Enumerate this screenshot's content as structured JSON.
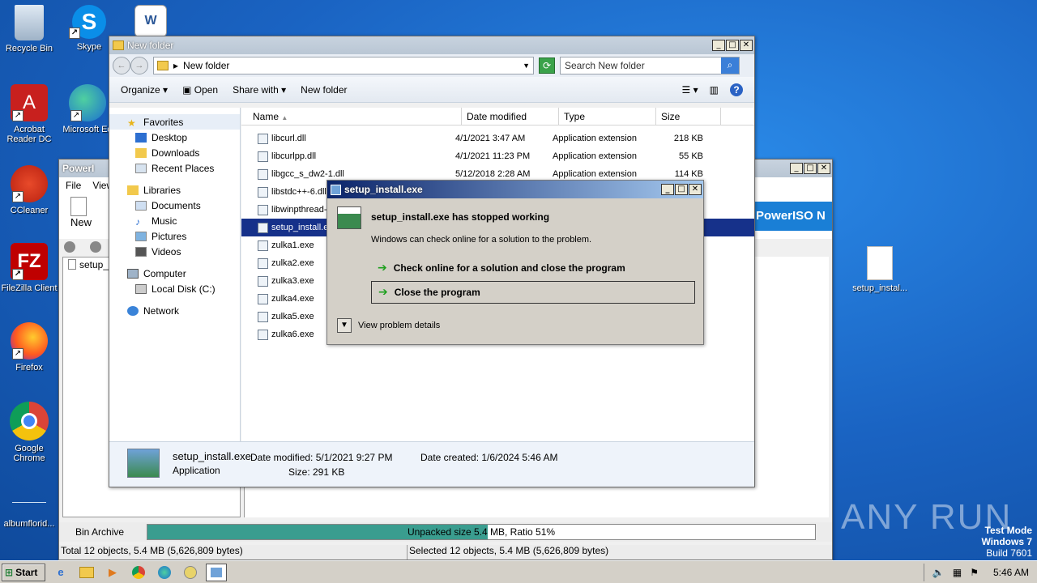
{
  "desktop": {
    "icons": [
      {
        "label": "Recycle Bin"
      },
      {
        "label": "Skype"
      },
      {
        "label": "Acrobat Reader DC"
      },
      {
        "label": "Microsoft Ed"
      },
      {
        "label": "CCleaner"
      },
      {
        "label": "FileZilla Client"
      },
      {
        "label": "Firefox"
      },
      {
        "label": "Google Chrome"
      },
      {
        "label": "albumflorid..."
      },
      {
        "label": "setup_instal..."
      }
    ],
    "watermark": "ANY RUN",
    "test_mode": {
      "line1": "Test Mode",
      "line2": "Windows 7",
      "line3": "Build 7601"
    }
  },
  "explorer": {
    "title": "New folder",
    "address": "New folder",
    "search_placeholder": "Search New folder",
    "toolbar": {
      "organize": "Organize",
      "open": "Open",
      "share_with": "Share with",
      "new_folder": "New folder"
    },
    "nav": {
      "favorites": "Favorites",
      "desktop": "Desktop",
      "downloads": "Downloads",
      "recent_places": "Recent Places",
      "libraries": "Libraries",
      "documents": "Documents",
      "music": "Music",
      "pictures": "Pictures",
      "videos": "Videos",
      "computer": "Computer",
      "local_disk": "Local Disk (C:)",
      "network": "Network"
    },
    "columns": {
      "name": "Name",
      "date": "Date modified",
      "type": "Type",
      "size": "Size"
    },
    "files": [
      {
        "name": "libcurl.dll",
        "date": "4/1/2021 3:47 AM",
        "type": "Application extension",
        "size": "218 KB"
      },
      {
        "name": "libcurlpp.dll",
        "date": "4/1/2021 11:23 PM",
        "type": "Application extension",
        "size": "55 KB"
      },
      {
        "name": "libgcc_s_dw2-1.dll",
        "date": "5/12/2018 2:28 AM",
        "type": "Application extension",
        "size": "114 KB"
      },
      {
        "name": "libstdc++-6.dll",
        "date": "",
        "type": "",
        "size": "KB"
      },
      {
        "name": "libwinpthread-",
        "date": "",
        "type": "",
        "size": "KB"
      },
      {
        "name": "setup_install.e",
        "date": "",
        "type": "",
        "size": "KB"
      },
      {
        "name": "zulka1.exe",
        "date": "",
        "type": "",
        "size": "KB"
      },
      {
        "name": "zulka2.exe",
        "date": "",
        "type": "",
        "size": "KB"
      },
      {
        "name": "zulka3.exe",
        "date": "",
        "type": "",
        "size": "KB"
      },
      {
        "name": "zulka4.exe",
        "date": "",
        "type": "",
        "size": "KB"
      },
      {
        "name": "zulka5.exe",
        "date": "",
        "type": "",
        "size": "KB"
      },
      {
        "name": "zulka6.exe",
        "date": "",
        "type": "",
        "size": "KB"
      }
    ],
    "details": {
      "filename": "setup_install.exe",
      "kind": "Application",
      "date_modified": "Date modified: 5/1/2021 9:27 PM",
      "size": "Size: 291 KB",
      "date_created": "Date created: 1/6/2024 5:46 AM"
    }
  },
  "poweriso": {
    "title": "PowerI",
    "menu_file": "File",
    "menu_view": "View",
    "new_label": "New",
    "file_item": "setup_",
    "banner": "PowerISO N",
    "status_label": "Bin Archive",
    "progress_text": "Unpacked size 5.4 MB, Ratio 51%",
    "progress": 0.51,
    "status_left": "Total 12 objects, 5.4 MB (5,626,809 bytes)",
    "status_right": "Selected 12 objects, 5.4 MB (5,626,809 bytes)"
  },
  "crash_dialog": {
    "title": "setup_install.exe",
    "heading": "setup_install.exe has stopped working",
    "message": "Windows can check online for a solution to the problem.",
    "option1": "Check online for a solution and close the program",
    "option2": "Close the program",
    "details": "View problem details"
  },
  "taskbar": {
    "start": "Start",
    "clock": "5:46 AM"
  }
}
